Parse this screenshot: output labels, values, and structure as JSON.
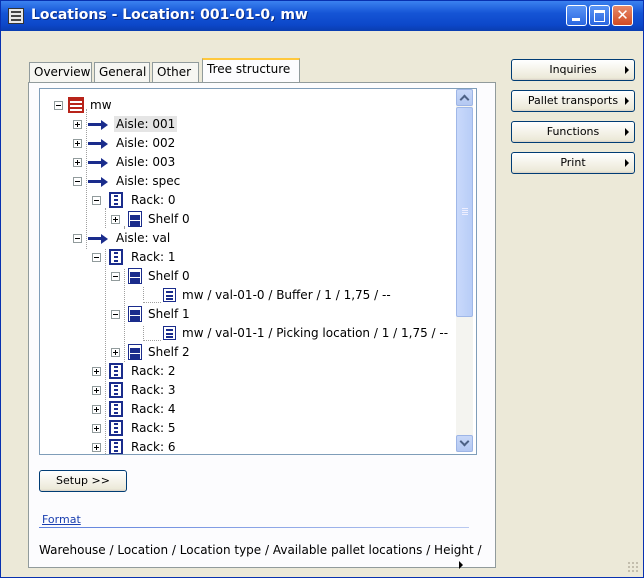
{
  "window": {
    "title": "Locations - Location: 001-01-0, mw",
    "close_glyph": "✕"
  },
  "tabs": [
    {
      "label": "Overview"
    },
    {
      "label": "General"
    },
    {
      "label": "Other"
    },
    {
      "label": "Tree structure",
      "active": true
    }
  ],
  "tree": {
    "root": "mw",
    "aisle_001": "Aisle: 001",
    "aisle_002": "Aisle: 002",
    "aisle_003": "Aisle: 003",
    "aisle_spec": "Aisle: spec",
    "rack_0": "Rack: 0",
    "shelf_0_spec": "Shelf 0",
    "aisle_val": "Aisle: val",
    "rack_1": "Rack: 1",
    "shelf_0": "Shelf 0",
    "loc_0": "mw / val-01-0 / Buffer / 1 / 1,75 / --",
    "shelf_1": "Shelf 1",
    "loc_1": "mw / val-01-1 / Picking location / 1 / 1,75 / --",
    "shelf_2": "Shelf 2",
    "rack_2": "Rack: 2",
    "rack_3": "Rack: 3",
    "rack_4": "Rack: 4",
    "rack_5": "Rack: 5",
    "rack_6": "Rack: 6"
  },
  "buttons": {
    "setup": "Setup >>",
    "inquiries": "Inquiries",
    "pallet_transports": "Pallet transports",
    "functions": "Functions",
    "print": "Print"
  },
  "format": {
    "link": "Format",
    "text": "Warehouse / Location / Location type / Available pallet locations / Height /"
  },
  "colors": {
    "titlebar": "#0c47c9",
    "accent": "#ffc83c"
  }
}
